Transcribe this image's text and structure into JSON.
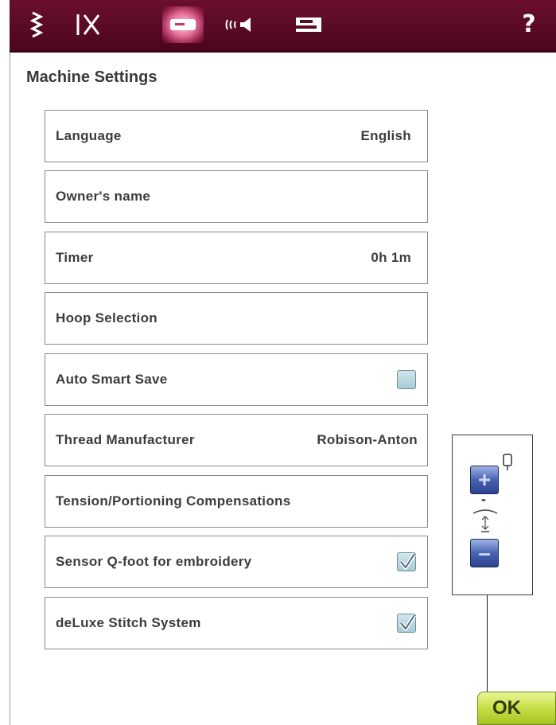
{
  "toolbar": {
    "icons": [
      "stitch-zigzag-icon",
      "threading-scissors-icon",
      "machine-settings-icon",
      "sound-settings-icon",
      "machine-info-icon"
    ],
    "active": "machine-settings-icon",
    "help_label": "?"
  },
  "page": {
    "title": "Machine Settings"
  },
  "settings": [
    {
      "label": "Language",
      "value": "English"
    },
    {
      "label": "Owner's name",
      "value": ""
    },
    {
      "label": "Timer",
      "value": "0h 1m"
    },
    {
      "label": "Hoop Selection",
      "value": ""
    },
    {
      "label": "Auto Smart Save",
      "checkbox": false
    },
    {
      "label": "Thread Manufacturer",
      "value": "Robison-Anton"
    },
    {
      "label": "Tension/Portioning Compensations",
      "value": ""
    },
    {
      "label": "Sensor Q-foot for embroidery",
      "checkbox": true
    },
    {
      "label": "deLuxe Stitch System",
      "checkbox": true
    }
  ],
  "presser_foot": {
    "plus_label": "+",
    "minus_label": "–",
    "mid_label": "-"
  },
  "ok_label": "OK",
  "colors": {
    "toolbar": "#5a0a24",
    "accent_green": "#c7de45",
    "button_blue": "#4a63b1"
  }
}
